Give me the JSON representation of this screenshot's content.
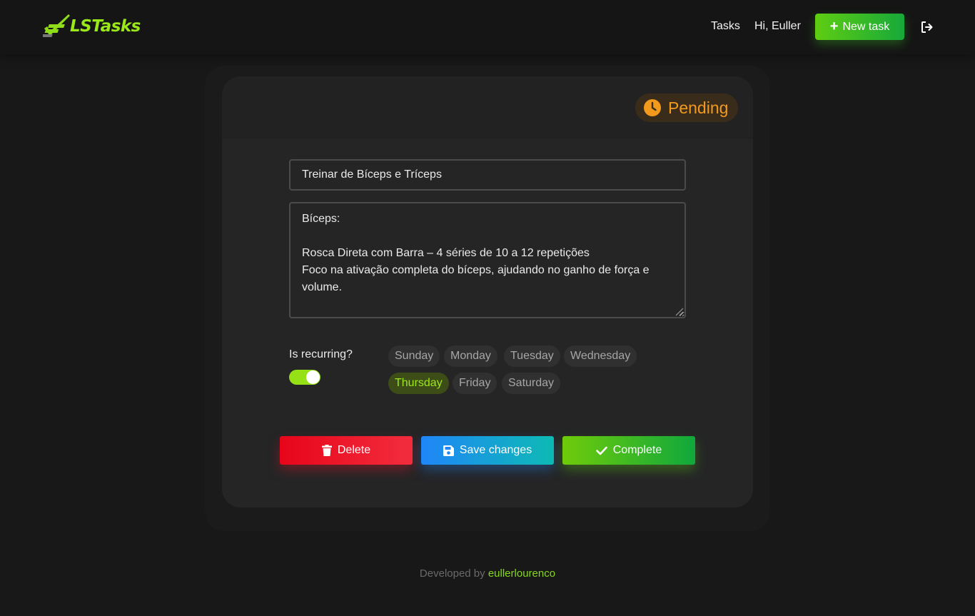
{
  "navbar": {
    "logo_text": "LSTasks",
    "tasks_link": "Tasks",
    "greeting": "Hi, Euller",
    "new_task_label": "New task"
  },
  "task": {
    "status": "Pending",
    "title": "Treinar de Bíceps e Tríceps",
    "description": "Bíceps:\n\nRosca Direta com Barra – 4 séries de 10 a 12 repetições\nFoco na ativação completa do bíceps, ajudando no ganho de força e volume.\n\n",
    "recurring_label": "Is recurring?",
    "is_recurring": true,
    "days": [
      {
        "label": "Sunday",
        "selected": false
      },
      {
        "label": "Monday",
        "selected": false
      },
      {
        "label": "Tuesday",
        "selected": false
      },
      {
        "label": "Wednesday",
        "selected": false
      },
      {
        "label": "Thursday",
        "selected": true
      },
      {
        "label": "Friday",
        "selected": false
      },
      {
        "label": "Saturday",
        "selected": false
      }
    ]
  },
  "actions": {
    "delete_label": "Delete",
    "save_label": "Save changes",
    "complete_label": "Complete"
  },
  "footer": {
    "prefix": "Developed by",
    "author": "eullerlourenco"
  },
  "colors": {
    "accent_green": "#9be81a",
    "pending_orange": "#f39a1d",
    "delete_red": "#e8051a",
    "save_blue": "#1f86f8"
  }
}
